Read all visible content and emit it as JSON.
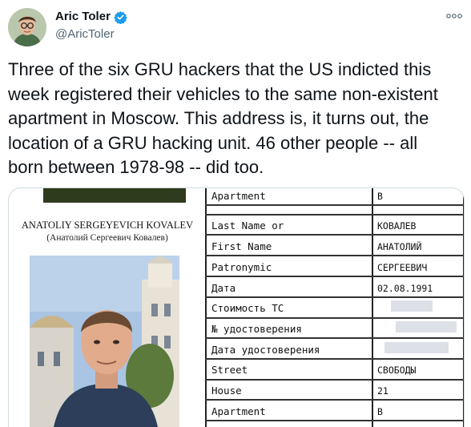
{
  "author": {
    "name": "Aric Toler",
    "handle": "@AricToler"
  },
  "tweet": {
    "text": "Three of the six GRU hackers that the US indicted this\nweek registered their vehicles to the same non-existent\napartment in Moscow. This address is, it turns out, the\nlocation of a GRU hacking unit. 46 other people -- all\nborn between 1978-98 -- did too."
  },
  "media": {
    "person_name": "ANATOLIY SERGEYEVICH KOVALEV",
    "person_name_ru": "(Анатолий Сергеевич Ковалев)",
    "rows": [
      {
        "label": "Apartment",
        "value": "В"
      },
      {
        "label": "Last Name or",
        "value": "КОВАЛЕВ"
      },
      {
        "label": "First Name",
        "value": "АНАТОЛИЙ"
      },
      {
        "label": "Patronymic",
        "value": "СЕРГЕЕВИЧ"
      },
      {
        "label": "Дата",
        "value": "02.08.1991"
      },
      {
        "label": "Стоимость ТС",
        "value": ""
      },
      {
        "label": "№ удостоверения",
        "value": ""
      },
      {
        "label": "Дата удостоверения",
        "value": ""
      },
      {
        "label": "Street",
        "value": "СВОБОДЫ"
      },
      {
        "label": "House",
        "value": "21"
      },
      {
        "label": "Apartment",
        "value": "В"
      }
    ]
  },
  "colors": {
    "verified": "#1d9bf0",
    "handle": "#536471",
    "text": "#0f1419"
  }
}
